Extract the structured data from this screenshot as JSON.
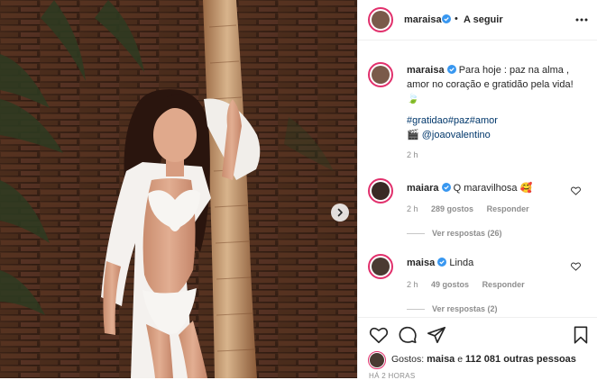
{
  "post": {
    "author": "maraisa",
    "follow_separator": "•",
    "follow_label": "A seguir",
    "caption_lines": [
      "Para hoje : paz na alma ,",
      "amor no coração e gratidão pela vida!"
    ],
    "leaf_emoji": "🍃",
    "hashtags": [
      "#gratidao",
      "#paz",
      "#amor"
    ],
    "camera_emoji": "🎬",
    "mention": "@joaovalentino",
    "caption_time": "2 h"
  },
  "comments": [
    {
      "user": "maiara",
      "text": "Q maravilhosa",
      "emoji": "🥰",
      "time": "2 h",
      "likes": "289 gostos",
      "reply_label": "Responder",
      "view_replies": "Ver respostas (26)"
    },
    {
      "user": "maisa",
      "text": "Linda",
      "emoji": "",
      "time": "2 h",
      "likes": "49 gostos",
      "reply_label": "Responder",
      "view_replies": "Ver respostas (2)"
    }
  ],
  "likes_bar": {
    "prefix": "Gostos:",
    "first_liker": "maisa",
    "connector": "e",
    "others": "112 081 outras pessoas",
    "posted_ago": "HÁ 2 HORAS"
  },
  "icons": {
    "more": "more-horizontal-icon",
    "verified": "verified-badge-icon",
    "heart": "heart-icon",
    "comment": "comment-icon",
    "share": "share-icon",
    "save": "bookmark-icon",
    "next": "chevron-right-icon"
  },
  "colors": {
    "accent_link": "#00376b",
    "verified_blue": "#3897f0",
    "story_ring": "#e1306c",
    "muted": "#8e8e8e"
  }
}
